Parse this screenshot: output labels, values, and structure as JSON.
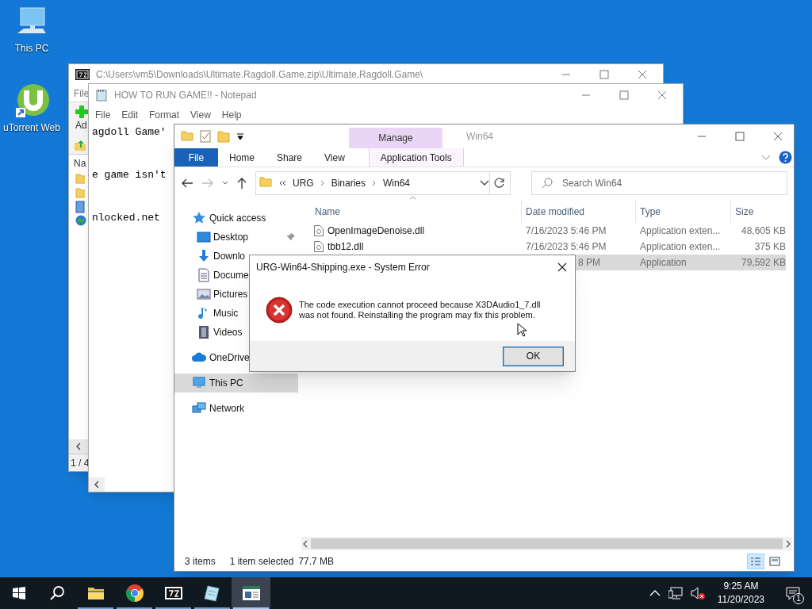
{
  "desktop_icons": [
    {
      "label": "This PC",
      "kind": "pc"
    },
    {
      "label": "uTorrent Web",
      "kind": "torrent"
    }
  ],
  "archive_window": {
    "title": "C:\\Users\\vm5\\Downloads\\Ultimate.Ragdoll.Game.zip\\Ultimate.Ragdoll.Game\\",
    "menu_item": "File",
    "toolbar_label": "Ad",
    "column_1": "Na",
    "status": "1 / 4"
  },
  "notepad": {
    "title": "HOW TO RUN GAME!! - Notepad",
    "menu": [
      "File",
      "Edit",
      "Format",
      "View",
      "Help"
    ],
    "lines": [
      "agdoll Game'",
      "e game isn't",
      "nlocked.net"
    ]
  },
  "explorer": {
    "title": "Win64",
    "context_tab": "Manage",
    "tabs": [
      {
        "label": "File",
        "kind": "file"
      },
      {
        "label": "Home",
        "kind": "tab"
      },
      {
        "label": "Share",
        "kind": "tab"
      },
      {
        "label": "View",
        "kind": "tab"
      },
      {
        "label": "Application Tools",
        "kind": "context"
      }
    ],
    "path": [
      "URG",
      "Binaries",
      "Win64"
    ],
    "search": {
      "placeholder": "Search Win64"
    },
    "nav": [
      {
        "label": "Quick access",
        "kind": "star",
        "selected": false,
        "children": [
          {
            "label": "Desktop",
            "kind": "desktop",
            "selected": false,
            "pinned": true
          },
          {
            "label": "Downlo",
            "kind": "download",
            "selected": false,
            "pinned": false
          },
          {
            "label": "Docume",
            "kind": "document",
            "selected": false,
            "pinned": false
          },
          {
            "label": "Pictures",
            "kind": "pictures",
            "selected": false,
            "pinned": false
          },
          {
            "label": "Music",
            "kind": "music",
            "selected": false,
            "pinned": false
          },
          {
            "label": "Videos",
            "kind": "videos",
            "selected": false,
            "pinned": false
          }
        ]
      },
      {
        "label": "OneDrive",
        "kind": "cloud",
        "selected": false
      },
      {
        "label": "This PC",
        "kind": "pc",
        "selected": true
      },
      {
        "label": "Network",
        "kind": "network",
        "selected": false
      }
    ],
    "columns": [
      "Name",
      "Date modified",
      "Type",
      "Size"
    ],
    "rows": [
      {
        "name": "OpenImageDenoise.dll",
        "date": "7/16/2023 5:46 PM",
        "type": "Application exten...",
        "size": "48,605 KB",
        "selected": false
      },
      {
        "name": "tbb12.dll",
        "date": "7/16/2023 5:46 PM",
        "type": "Application exten...",
        "size": "375 KB",
        "selected": false
      },
      {
        "date": "8 PM",
        "type": "Application",
        "size": "79,592 KB",
        "selected": true
      }
    ],
    "status": {
      "count": "3 items",
      "selection": "1 item selected",
      "size": "77.7 MB"
    }
  },
  "dialog": {
    "title": "URG-Win64-Shipping.exe - System Error",
    "message": "The code execution cannot proceed because X3DAudio1_7.dll was not found. Reinstalling the program may fix this problem.",
    "button": "OK"
  },
  "taskbar": {
    "apps": [
      {
        "kind": "folder",
        "running": true,
        "active": false
      },
      {
        "kind": "chrome",
        "running": true,
        "active": false
      },
      {
        "kind": "archive",
        "running": true,
        "active": false
      },
      {
        "kind": "notepad",
        "running": true,
        "active": false
      },
      {
        "kind": "window",
        "running": true,
        "active": true
      }
    ],
    "time": "9:25 AM",
    "date": "11/20/2023",
    "notifications": "1"
  }
}
